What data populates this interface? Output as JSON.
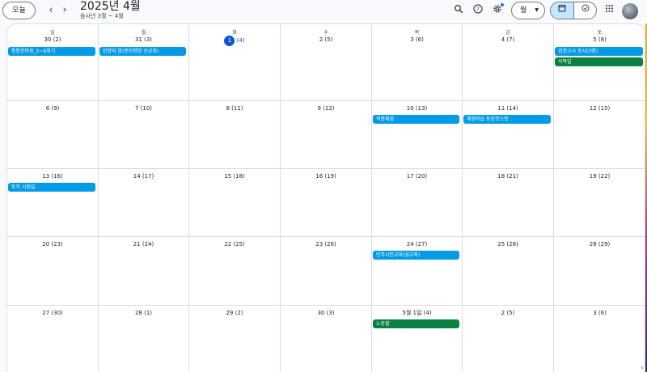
{
  "header": {
    "today_label": "오늘",
    "prev_icon": "‹",
    "next_icon": "›",
    "title": "2025년 4월",
    "subtitle": "음사년 3월 ~ 4월",
    "view_label": "월",
    "icons": {
      "search": "search-icon",
      "help": "help-icon",
      "settings": "gear-icon",
      "apps": "apps-grid-icon"
    }
  },
  "weekdays": [
    "일",
    "월",
    "화",
    "수",
    "목",
    "금",
    "토"
  ],
  "weeks": [
    [
      {
        "date": "30",
        "lunar": "(2)"
      },
      {
        "date": "31",
        "lunar": "(3)"
      },
      {
        "date": "1",
        "lunar": "(4)",
        "today": true
      },
      {
        "date": "2",
        "lunar": "(5)"
      },
      {
        "date": "3",
        "lunar": "(6)"
      },
      {
        "date": "4",
        "lunar": "(7)"
      },
      {
        "date": "5",
        "lunar": "(8)"
      }
    ],
    [
      {
        "date": "6",
        "lunar": "(9)"
      },
      {
        "date": "7",
        "lunar": "(10)"
      },
      {
        "date": "8",
        "lunar": "(11)"
      },
      {
        "date": "9",
        "lunar": "(12)"
      },
      {
        "date": "10",
        "lunar": "(13)"
      },
      {
        "date": "11",
        "lunar": "(14)"
      },
      {
        "date": "12",
        "lunar": "(15)"
      }
    ],
    [
      {
        "date": "13",
        "lunar": "(16)"
      },
      {
        "date": "14",
        "lunar": "(17)"
      },
      {
        "date": "15",
        "lunar": "(18)"
      },
      {
        "date": "16",
        "lunar": "(19)"
      },
      {
        "date": "17",
        "lunar": "(20)"
      },
      {
        "date": "18",
        "lunar": "(21)"
      },
      {
        "date": "19",
        "lunar": "(22)"
      }
    ],
    [
      {
        "date": "20",
        "lunar": "(23)"
      },
      {
        "date": "21",
        "lunar": "(24)"
      },
      {
        "date": "22",
        "lunar": "(25)"
      },
      {
        "date": "23",
        "lunar": "(26)"
      },
      {
        "date": "24",
        "lunar": "(27)"
      },
      {
        "date": "25",
        "lunar": "(28)"
      },
      {
        "date": "26",
        "lunar": "(29)"
      }
    ],
    [
      {
        "date": "27",
        "lunar": "(30)"
      },
      {
        "date": "28",
        "lunar": "(1)"
      },
      {
        "date": "29",
        "lunar": "(2)"
      },
      {
        "date": "30",
        "lunar": "(3)"
      },
      {
        "date": "5월 1일",
        "lunar": "(4)"
      },
      {
        "date": "2",
        "lunar": "(5)"
      },
      {
        "date": "3",
        "lunar": "(6)"
      }
    ]
  ],
  "events": [
    {
      "week": 0,
      "day": 0,
      "slot": 0,
      "title": "통통한마음_5~6회기",
      "color": "blue"
    },
    {
      "week": 0,
      "day": 1,
      "slot": 0,
      "title": "한양의 밤(춘천향양 선교회)",
      "color": "blue"
    },
    {
      "week": 0,
      "day": 6,
      "slot": 0,
      "title": "검정고시 응시(3명)",
      "color": "blue"
    },
    {
      "week": 0,
      "day": 6,
      "slot": 1,
      "title": "식목일",
      "color": "green"
    },
    {
      "week": 1,
      "day": 4,
      "slot": 0,
      "title": "직종체험",
      "color": "blue"
    },
    {
      "week": 1,
      "day": 5,
      "slot": 0,
      "title": "체험학습 동암캇스탓",
      "color": "blue"
    },
    {
      "week": 2,
      "day": 0,
      "slot": 0,
      "title": "토익 시험일",
      "color": "blue"
    },
    {
      "week": 3,
      "day": 4,
      "slot": 0,
      "title": "민주시민교육(성교육)",
      "color": "blue"
    },
    {
      "week": 4,
      "day": 4,
      "slot": 0,
      "title": "노동절",
      "color": "green"
    }
  ],
  "colors": {
    "blue": "#039be5",
    "green": "#0b8043",
    "today": "#0b57d0"
  }
}
